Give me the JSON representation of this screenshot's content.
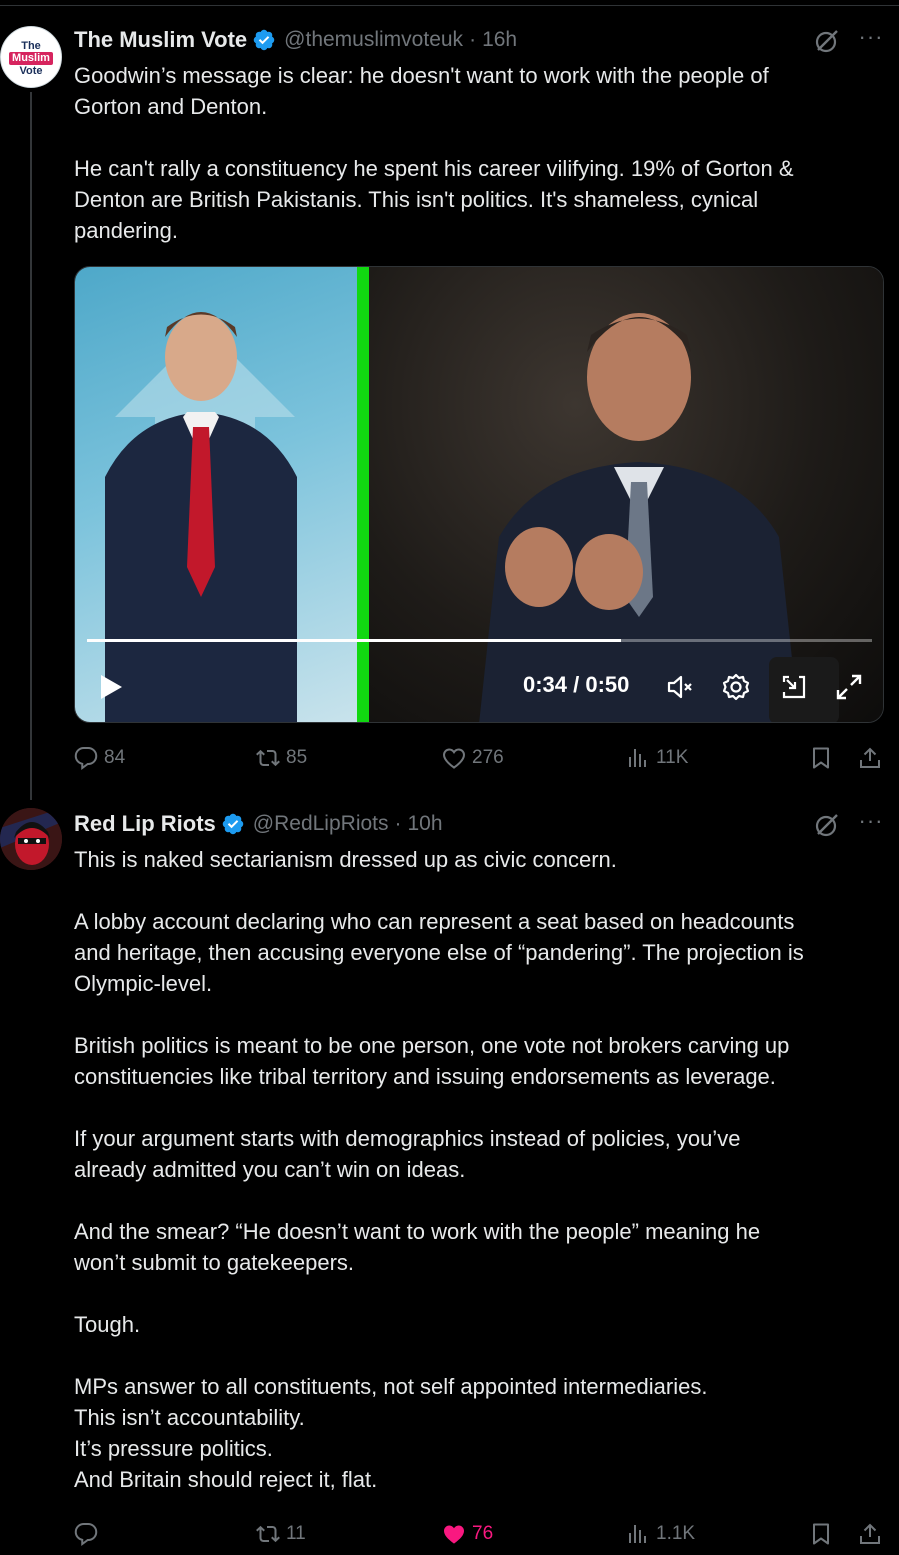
{
  "tweets": [
    {
      "author": {
        "name": "The Muslim Vote",
        "handle": "@themuslimvoteuk",
        "time": "16h",
        "avatar_text": [
          "The",
          "Muslim",
          "Vote"
        ]
      },
      "body": [
        "Goodwin’s message is clear: he doesn't want to work with the people of",
        "Gorton and Denton.",
        "",
        "He can't rally a constituency he spent his career vilifying. 19% of Gorton &",
        "Denton are British Pakistanis. This isn't politics. It's shameless, cynical",
        "pandering."
      ],
      "video": {
        "time": "0:34 / 0:50",
        "progress": 0.68
      },
      "stats": {
        "replies": "84",
        "reposts": "85",
        "likes": "276",
        "views": "11K"
      }
    },
    {
      "author": {
        "name": "Red Lip Riots",
        "handle": "@RedLipRiots",
        "time": "10h"
      },
      "body": [
        "This is naked sectarianism dressed up as civic concern.",
        "",
        "A lobby account declaring who can represent a seat based on headcounts",
        "and heritage, then accusing everyone else of “pandering”. The projection is",
        "Olympic-level.",
        "",
        "British politics is meant to be one person, one vote not brokers carving up",
        "constituencies like tribal territory and issuing endorsements as leverage.",
        "",
        "If your argument starts with demographics instead of policies, you’ve",
        "already admitted you can’t win on ideas.",
        "",
        "And the smear? “He doesn’t want to work with the people” meaning he",
        "won’t submit to gatekeepers.",
        "",
        "Tough.",
        "",
        "MPs answer to all constituents, not self appointed intermediaries.",
        "This isn’t accountability.",
        "It’s pressure politics.",
        "And Britain should reject it, flat."
      ],
      "stats": {
        "replies": "",
        "reposts": "11",
        "likes": "76",
        "views": "1.1K"
      }
    }
  ],
  "colors": {
    "background": "#000000",
    "text": "#e7e9ea",
    "muted": "#71767b",
    "verified": "#1d9bf0",
    "like": "#f91880",
    "divider": "#2f3336"
  },
  "icons": [
    "verified-badge-icon",
    "grok-icon",
    "more-icon",
    "reply-icon",
    "repost-icon",
    "like-icon",
    "views-icon",
    "bookmark-icon",
    "share-icon",
    "play-icon",
    "mute-icon",
    "settings-icon",
    "pip-icon",
    "fullscreen-icon"
  ]
}
